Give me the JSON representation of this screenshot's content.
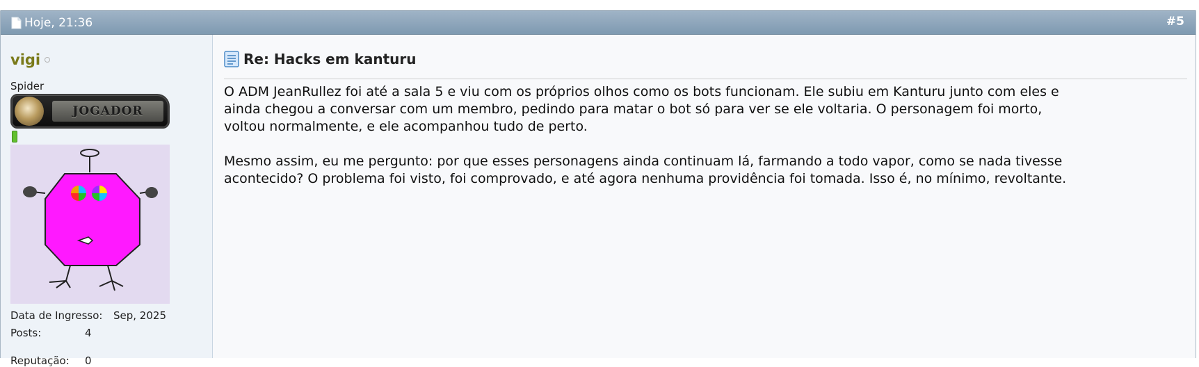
{
  "post": {
    "date": "Hoje, 21:36",
    "number": "#5",
    "title": "Re: Hacks em kanturu",
    "message": {
      "paragraph_1_lines": [
        "O ADM JeanRullez foi até a sala 5 e viu com os próprios olhos como os bots funcionam. Ele subiu em Kanturu junto com eles e",
        "ainda chegou a conversar com um membro, pedindo para matar o bot só para ver se ele voltaria. O personagem foi morto,",
        "voltou normalmente, e ele acompanhou tudo de perto."
      ],
      "paragraph_2_lines": [
        "Mesmo assim, eu me pergunto: por que esses personagens ainda continuam lá, farmando a todo vapor, como se nada tivesse",
        "acontecido? O problema foi visto, foi comprovado, e até agora nenhuma providência foi tomada. Isso é, no mínimo, revoltante."
      ]
    }
  },
  "user": {
    "username": "vigi",
    "title": "Spider",
    "rank_label": "JOGADOR",
    "stats": [
      {
        "label": "Data de Ingresso:",
        "value": "Sep, 2025"
      },
      {
        "label": "Posts:",
        "value": "4"
      },
      {
        "label": "Reputação:",
        "value": "0"
      }
    ]
  },
  "colors": {
    "header_bar": "#8aa3b9",
    "username": "#7a7a1a",
    "sidebar_bg": "#eef3f8",
    "avatar_bg": "#e3daf0",
    "avatar_body": "#ff19ff",
    "reputation_green": "#62c02f"
  },
  "icons": {
    "date": "document-icon",
    "title": "post-title-icon",
    "status": "offline-status-icon"
  }
}
